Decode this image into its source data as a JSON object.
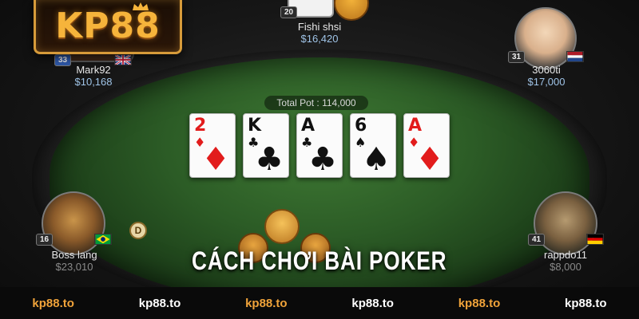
{
  "brand": {
    "logo_text": "KP88",
    "accent": "#f6b43b"
  },
  "table": {
    "pot_label": "Total Pot : 114,000",
    "dealer_button": "D",
    "community_cards": [
      {
        "rank": "2",
        "suit": "♦",
        "color": "red"
      },
      {
        "rank": "K",
        "suit": "♣",
        "color": "black"
      },
      {
        "rank": "A",
        "suit": "♣",
        "color": "black"
      },
      {
        "rank": "6",
        "suit": "♠",
        "color": "black"
      },
      {
        "rank": "A",
        "suit": "♦",
        "color": "red"
      }
    ]
  },
  "players": {
    "top": {
      "name": "Fishi shsi",
      "chips": "$16,420",
      "level": "20"
    },
    "top_left": {
      "name": "Mark92",
      "chips": "$10,168",
      "level": "33",
      "flag": "UK"
    },
    "top_right": {
      "name": "3060ti",
      "chips": "$17,000",
      "level": "31",
      "flag": "Netherlands"
    },
    "bottom_left": {
      "name": "Boss lang",
      "chips": "$23,010",
      "level": "16",
      "flag": "Brazil"
    },
    "bottom_right": {
      "name": "rappdo11",
      "chips": "$8,000",
      "level": "41",
      "flag": "Germany"
    }
  },
  "banner": {
    "title": "CÁCH CHƠI BÀI POKER"
  },
  "footer": {
    "links": [
      "kp88.to",
      "kp88.to",
      "kp88.to",
      "kp88.to",
      "kp88.to",
      "kp88.to"
    ]
  }
}
